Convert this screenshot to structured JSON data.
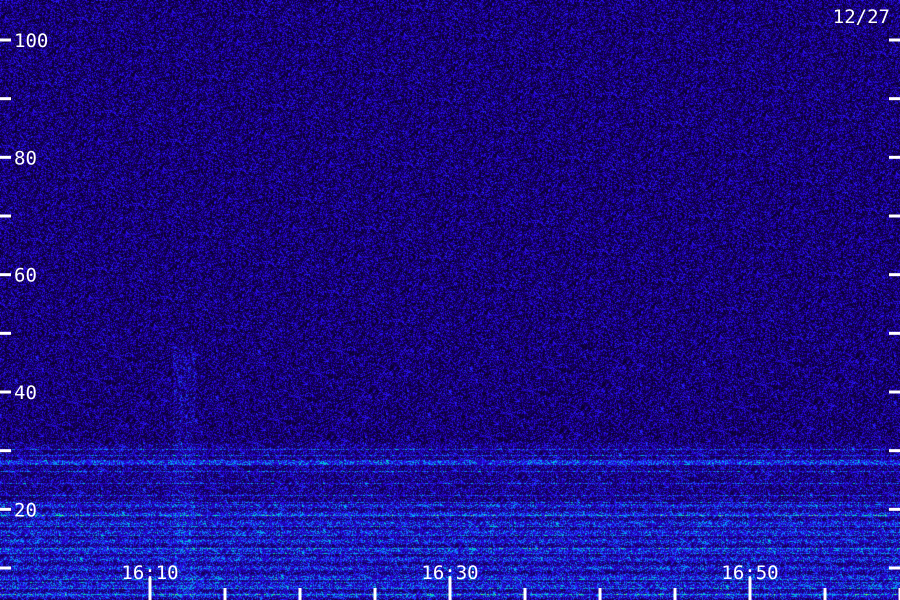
{
  "chart_data": {
    "type": "heatmap",
    "date_label": "12/27",
    "y_axis": {
      "range": [
        0,
        105
      ],
      "ticks": [
        10,
        20,
        30,
        40,
        50,
        60,
        70,
        80,
        90,
        100
      ],
      "tick_labels": [
        "",
        "20",
        "",
        "40",
        "",
        "60",
        "",
        "80",
        "",
        "100"
      ]
    },
    "x_axis": {
      "range": [
        "16:06",
        "17:00"
      ],
      "major_ticks": [
        "16:10",
        "16:30",
        "16:50"
      ],
      "minor_tick_interval_minutes": 5
    },
    "intensity_bands": [
      {
        "low": 0,
        "high": 20,
        "level": "strong"
      },
      {
        "low": 20,
        "high": 30,
        "level": "moderate"
      },
      {
        "low": 30,
        "high": 105,
        "level": "background"
      }
    ],
    "colors": {
      "background": "#1c0f5e",
      "low": "#0000ff",
      "mid": "#00bfff",
      "high": "#00ff90",
      "peak": "#b0ff40",
      "axis": "#ffffff"
    }
  }
}
